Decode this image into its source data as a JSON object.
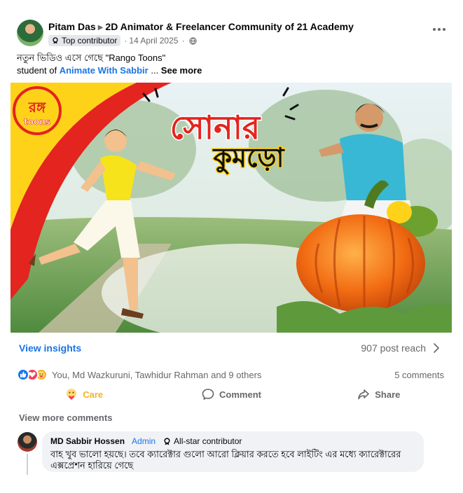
{
  "post": {
    "author": "Pitam Das",
    "group": "2D Animator & Freelancer Community of 21 Academy",
    "badge": "Top contributor",
    "date": "14 April 2025",
    "caption_line1": "নতুন ভিডিও এসে গেছে \"Rango Toons\"",
    "caption_prefix": "student of ",
    "caption_link": "Animate With Sabbir",
    "caption_ellipsis": " ... ",
    "see_more": "See more"
  },
  "thumbnail": {
    "logo_text_top": "রঙ্গ",
    "logo_text_bottom": "toons",
    "title_line1": "সোনার",
    "title_line2": "কুমড়ো"
  },
  "insights": {
    "view_label": "View insights",
    "reach": "907 post reach"
  },
  "reactions": {
    "names": "You, Md Wazkuruni, Tawhidur Rahman and 9 others",
    "comments": "5 comments"
  },
  "actions": {
    "care": "Care",
    "comment": "Comment",
    "share": "Share"
  },
  "comments_section": {
    "view_more": "View more comments",
    "comment": {
      "name": "MD Sabbir Hossen",
      "role": "Admin",
      "badge": "All-star contributor",
      "text": "বাহ খুব ভালো হয়ছে। তবে ক্যারেক্টার গুলো আরো ক্লিয়ার করতে হবে লাইটিং এর মধ্যে ক্যারেক্টারের এক্সপ্রেশন হারিয়ে গেছে"
    }
  },
  "colors": {
    "link_blue": "#1b74e4",
    "secondary_text": "#65676b",
    "bubble_bg": "#f0f2f5",
    "like": "#1877f2",
    "love": "#f33e58",
    "care": "#f7b125"
  }
}
